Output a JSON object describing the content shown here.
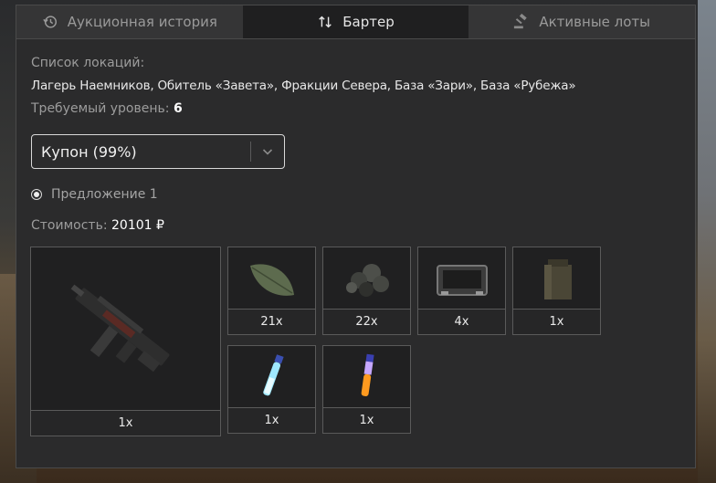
{
  "tabs": [
    {
      "label": "Аукционная история",
      "icon": "history-icon"
    },
    {
      "label": "Бартер",
      "icon": "swap-icon"
    },
    {
      "label": "Активные лоты",
      "icon": "gavel-icon"
    }
  ],
  "locations": {
    "label": "Список локаций:",
    "value": "Лагерь Наемников, Обитель «Завета», Фракции Севера, База «Зари», База «Рубежа»"
  },
  "level": {
    "label": "Требуемый уровень:",
    "value": "6"
  },
  "select": {
    "value": "Купон (99%)"
  },
  "offer": {
    "label": "Предложение 1"
  },
  "cost": {
    "label": "Стоимость:",
    "value": "20101 ₽"
  },
  "items": [
    {
      "name": "weapon-smg",
      "qty": "1x"
    },
    {
      "name": "leaf",
      "qty": "21x"
    },
    {
      "name": "dark-pearls",
      "qty": "22x"
    },
    {
      "name": "tablet-device",
      "qty": "4x"
    },
    {
      "name": "ammo-box",
      "qty": "1x"
    },
    {
      "name": "blue-vial",
      "qty": "1x"
    },
    {
      "name": "orange-vial",
      "qty": "1x"
    }
  ],
  "colors": {
    "panel": "#2b2b2c",
    "active_tab": "#1f1f20",
    "border": "#4a4a4a"
  }
}
